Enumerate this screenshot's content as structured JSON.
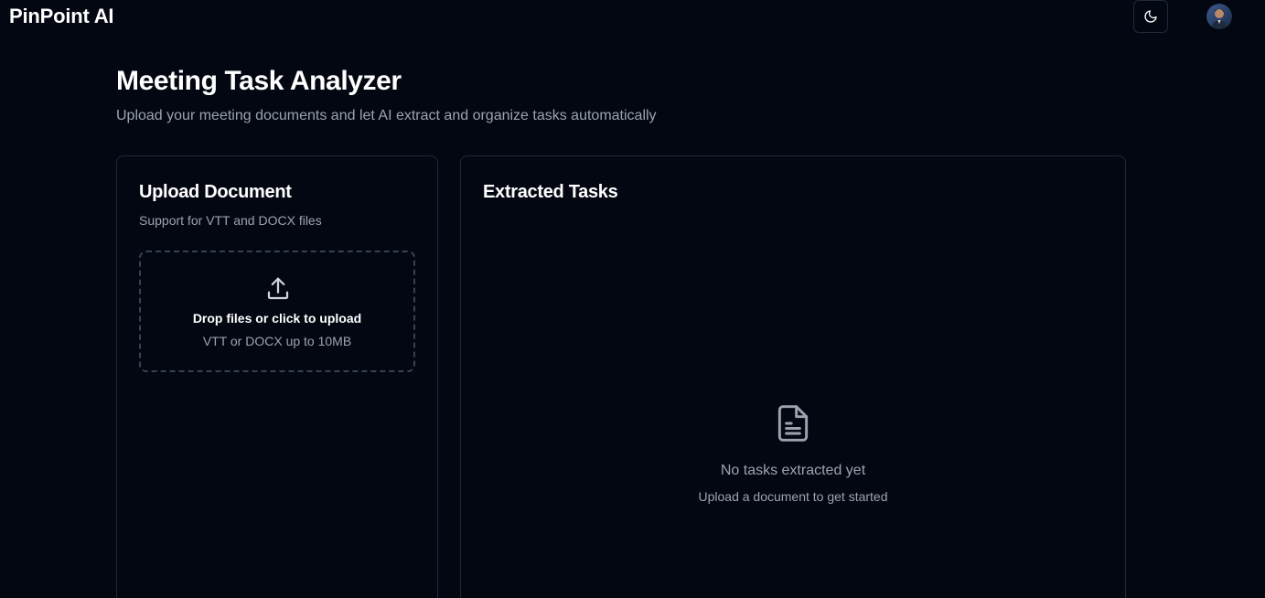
{
  "header": {
    "brand": "PinPoint AI",
    "theme_toggle_icon": "moon-icon",
    "avatar_icon": "user-avatar"
  },
  "page": {
    "title": "Meeting Task Analyzer",
    "subtitle": "Upload your meeting documents and let AI extract and organize tasks automatically"
  },
  "upload_card": {
    "title": "Upload Document",
    "description": "Support for VTT and DOCX files",
    "dropzone": {
      "icon": "upload-icon",
      "main_text": "Drop files or click to upload",
      "sub_text": "VTT or DOCX up to 10MB"
    }
  },
  "tasks_card": {
    "title": "Extracted Tasks",
    "empty_state": {
      "icon": "document-icon",
      "title": "No tasks extracted yet",
      "subtitle": "Upload a document to get started"
    }
  },
  "colors": {
    "background": "#030712",
    "border": "#1f2937",
    "muted_text": "#9ca3af",
    "heading_text": "#ffffff"
  }
}
